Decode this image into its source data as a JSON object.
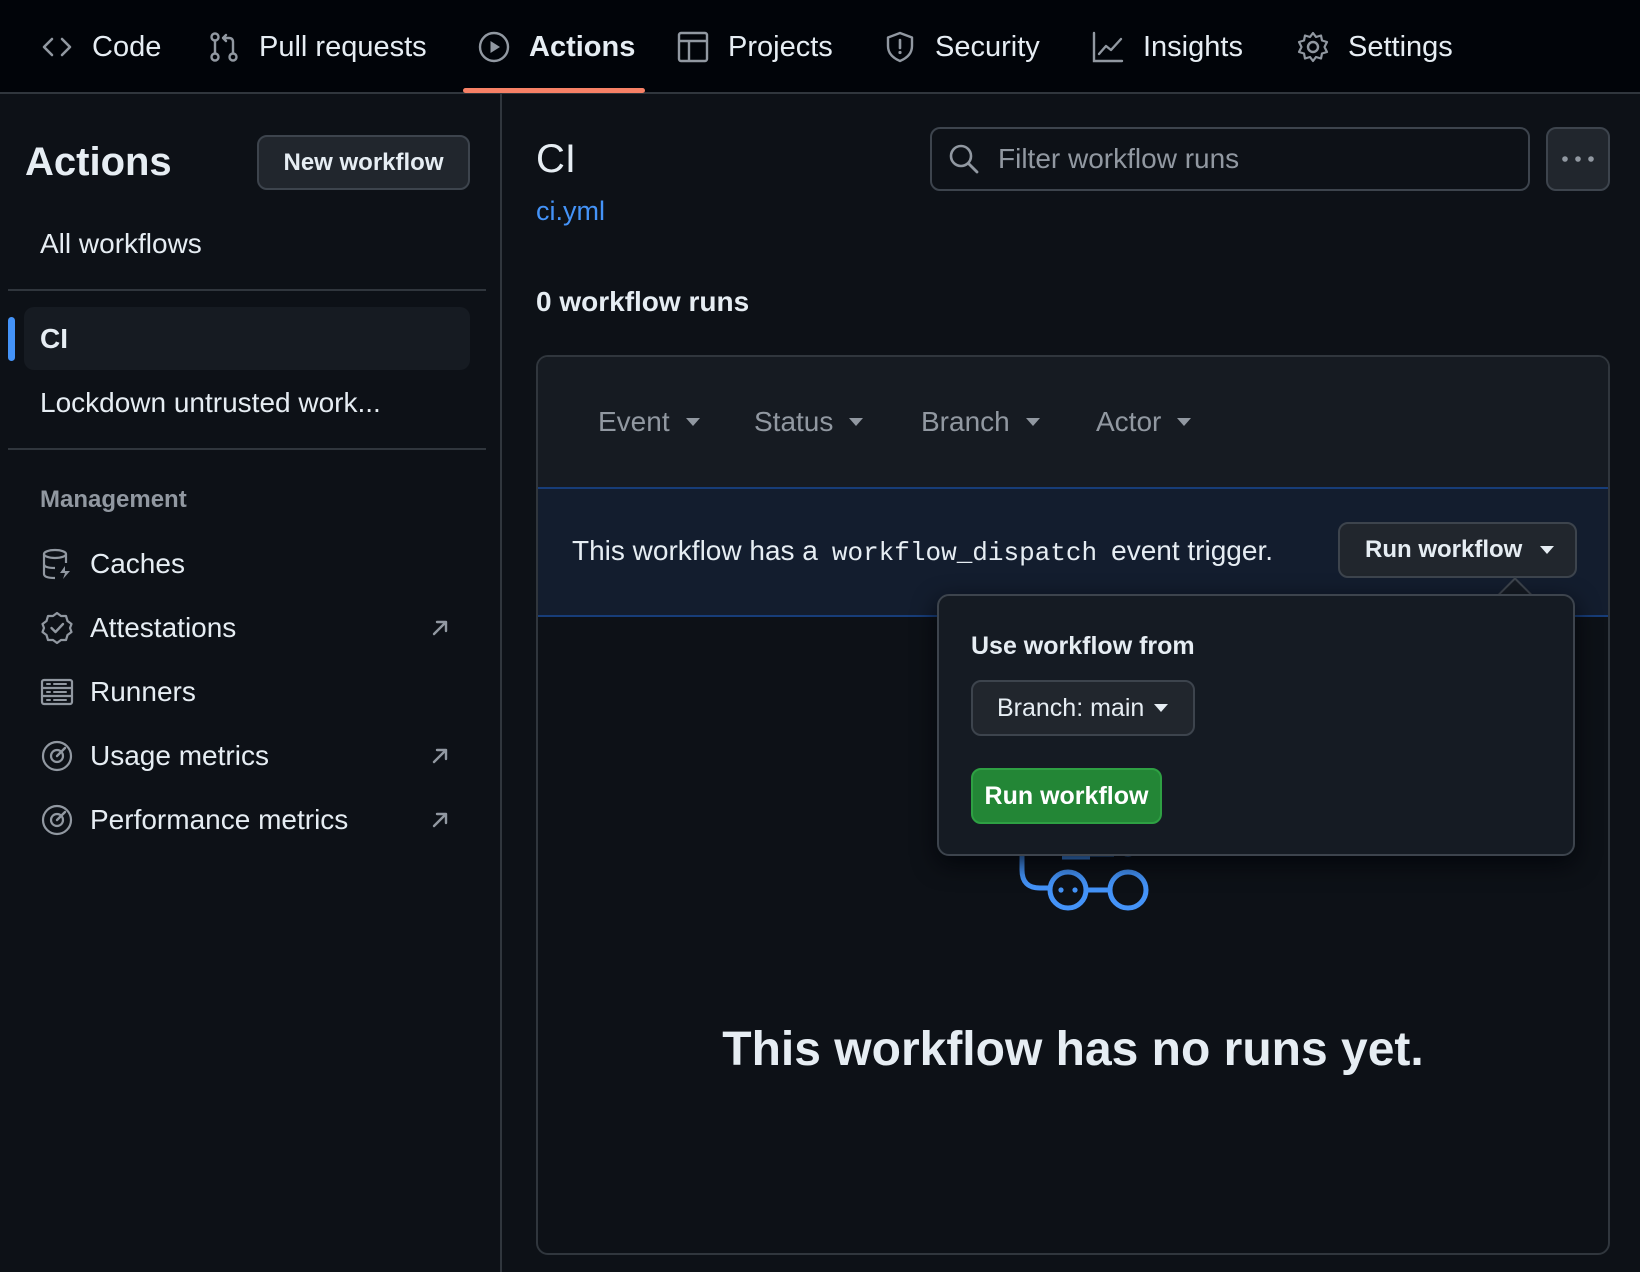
{
  "nav": {
    "tabs": [
      {
        "label": "Code",
        "icon": "code-icon"
      },
      {
        "label": "Pull requests",
        "icon": "git-pull-request-icon"
      },
      {
        "label": "Actions",
        "icon": "play-icon",
        "active": true
      },
      {
        "label": "Projects",
        "icon": "table-icon"
      },
      {
        "label": "Security",
        "icon": "shield-icon"
      },
      {
        "label": "Insights",
        "icon": "graph-icon"
      },
      {
        "label": "Settings",
        "icon": "gear-icon"
      }
    ],
    "active_underline_color": "#f78166"
  },
  "sidebar": {
    "title": "Actions",
    "new_workflow_label": "New workflow",
    "all_workflows_label": "All workflows",
    "workflows": [
      {
        "label": "CI",
        "selected": true
      },
      {
        "label": "Lockdown untrusted work..."
      }
    ],
    "management_heading": "Management",
    "management_items": [
      {
        "label": "Caches",
        "icon": "database-icon",
        "external": false
      },
      {
        "label": "Attestations",
        "icon": "verified-icon",
        "external": true
      },
      {
        "label": "Runners",
        "icon": "server-icon",
        "external": false
      },
      {
        "label": "Usage metrics",
        "icon": "meter-icon",
        "external": true
      },
      {
        "label": "Performance metrics",
        "icon": "meter-icon",
        "external": true
      }
    ]
  },
  "main": {
    "workflow_title": "CI",
    "workflow_file": "ci.yml",
    "search_placeholder": "Filter workflow runs",
    "runs_count": "0 workflow runs",
    "filters": [
      "Event",
      "Status",
      "Branch",
      "Actor"
    ],
    "banner": {
      "text_before": "This workflow has a",
      "code": "workflow_dispatch",
      "text_after": "event trigger.",
      "run_button_label": "Run workflow"
    },
    "empty_title": "This workflow has no runs yet."
  },
  "popover": {
    "label": "Use workflow from",
    "branch_button_label": "Branch: main",
    "run_button_label": "Run workflow"
  },
  "colors": {
    "accent_blue": "#4493f8",
    "run_green": "#238636",
    "background": "#0d1117"
  }
}
